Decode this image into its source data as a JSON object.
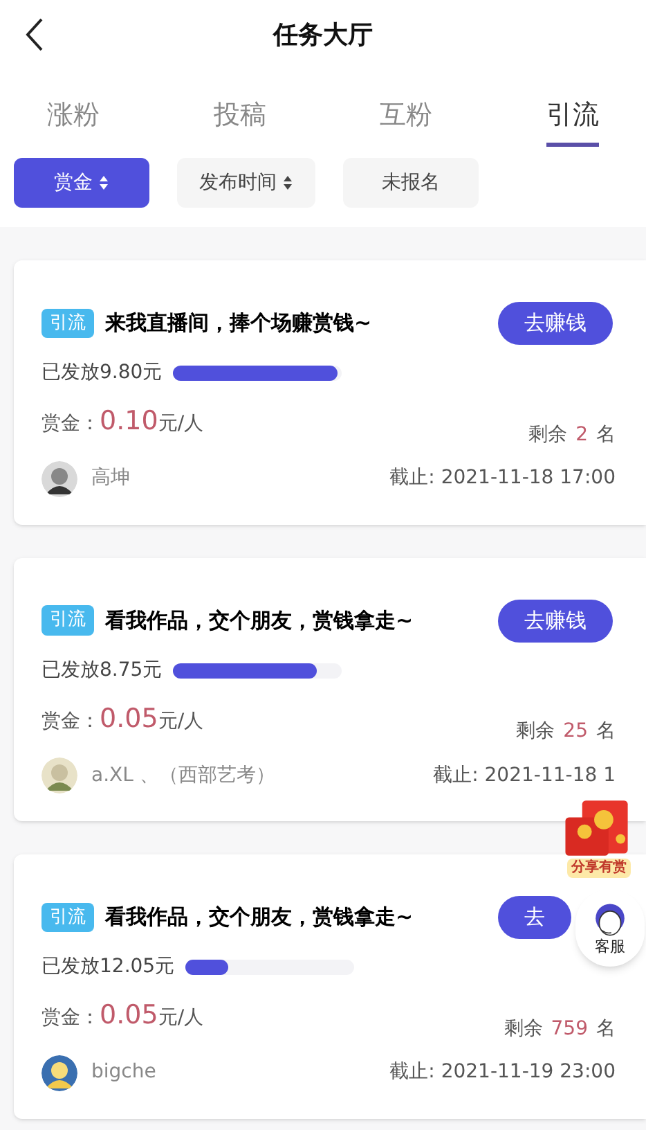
{
  "header": {
    "title": "任务大厅"
  },
  "tabs": [
    {
      "label": "涨粉",
      "selected": false
    },
    {
      "label": "投稿",
      "selected": false
    },
    {
      "label": "互粉",
      "selected": false
    },
    {
      "label": "引流",
      "selected": true
    }
  ],
  "filters": [
    {
      "label": "赏金",
      "selected": true,
      "sortable": true
    },
    {
      "label": "发布时间",
      "selected": false,
      "sortable": true
    },
    {
      "label": "未报名",
      "selected": false,
      "sortable": false
    }
  ],
  "tasks": [
    {
      "tag": "引流",
      "title": "来我直播间，捧个场赚赏钱~",
      "button": "去赚钱",
      "paid": "已发放9.80元",
      "level": 0.97,
      "reward_label": "赏金：",
      "reward": "0.10",
      "reward_unit": "元/人",
      "remaining_label": "剩余",
      "remaining": "2",
      "remaining_unit": "名",
      "user": "高坤",
      "deadline": "截止: 2021-11-18 17:00"
    },
    {
      "tag": "引流",
      "title": "看我作品，交个朋友，赏钱拿走~",
      "button": "去赚钱",
      "paid": "已发放8.75元",
      "level": 0.85,
      "reward_label": "赏金：",
      "reward": "0.05",
      "reward_unit": "元/人",
      "remaining_label": "剩余",
      "remaining": "25",
      "remaining_unit": "名",
      "user": "a.XL 、（西部艺考）",
      "deadline": "截止: 2021-11-18 1"
    },
    {
      "tag": "引流",
      "title": "看我作品，交个朋友，赏钱拿走~",
      "button": "去",
      "paid": "已发放12.05元",
      "level": 0.25,
      "reward_label": "赏金：",
      "reward": "0.05",
      "reward_unit": "元/人",
      "remaining_label": "剩余",
      "remaining": "759",
      "remaining_unit": "名",
      "user": "bigche",
      "deadline": "截止: 2021-11-19 23:00"
    }
  ],
  "share_reward": {
    "label": "分享有赏"
  },
  "customer_service": {
    "label": "客服"
  }
}
